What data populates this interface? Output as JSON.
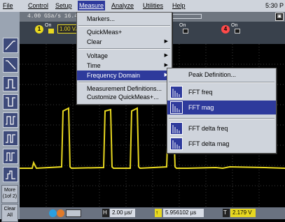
{
  "menubar": {
    "items": [
      "File",
      "Control",
      "Setup",
      "Measure",
      "Analyze",
      "Utilities",
      "Help"
    ],
    "time": "5:30 P"
  },
  "status": {
    "rate": "4.00 GSa/s  16.4"
  },
  "channels": {
    "ch1_num": "1",
    "ch1_value": "1.00 V/",
    "ch4_num": "4",
    "on_label": "On"
  },
  "toolbar": {
    "more_label": "More (1of 2)",
    "clear_label": "Clear All"
  },
  "measure_menu": {
    "items": [
      "Markers...",
      "QuickMeas+",
      "Clear",
      "Voltage",
      "Time",
      "Frequency Domain",
      "Measurement Definitions...",
      "Customize QuickMeas+..."
    ]
  },
  "freq_submenu": {
    "items": [
      "Peak Definition...",
      "FFT freq",
      "FFT mag",
      "FFT delta freq",
      "FFT delta mag"
    ]
  },
  "bottombar": {
    "timebase": "2.00 µs/",
    "position": "5.956102 µs",
    "trigger": "2.179 V",
    "h_label": "H",
    "t_label": "T"
  },
  "colors": {
    "accent": "#2e3a9c",
    "trace": "#e8d820",
    "chip1": "#e8d820",
    "chip4": "#ff4a4a"
  }
}
